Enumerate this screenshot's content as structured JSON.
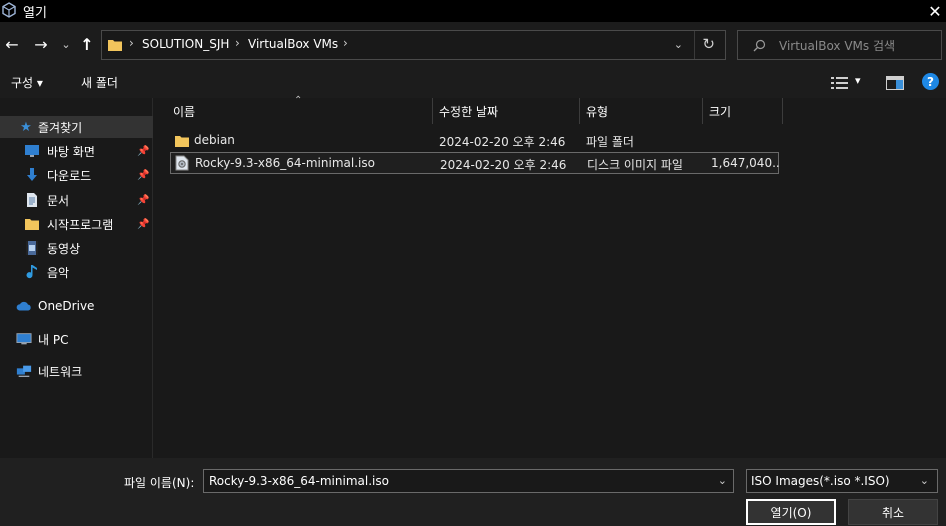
{
  "window": {
    "title": "열기",
    "close_label": "✕"
  },
  "nav": {
    "back": "←",
    "forward": "→",
    "recent": "⌄",
    "up": "↑",
    "breadcrumb": [
      "SOLUTION_SJH",
      "VirtualBox VMs"
    ],
    "separator": "›",
    "dropdown": "⌄",
    "refresh": "↻"
  },
  "search": {
    "placeholder": "VirtualBox VMs 검색"
  },
  "toolbar": {
    "organize": "구성 ▾",
    "new_folder": "새 폴더",
    "view_dropdown": "▾",
    "help": "?"
  },
  "sidebar": {
    "items": [
      {
        "label": "즐겨찾기",
        "icon": "star-icon",
        "pinned": false,
        "selected": true
      },
      {
        "label": "바탕 화면",
        "icon": "desktop-icon",
        "pinned": true
      },
      {
        "label": "다운로드",
        "icon": "download-icon",
        "pinned": true
      },
      {
        "label": "문서",
        "icon": "document-icon",
        "pinned": true
      },
      {
        "label": "시작프로그램",
        "icon": "folder-icon",
        "pinned": true
      },
      {
        "label": "동영상",
        "icon": "video-icon",
        "pinned": false
      },
      {
        "label": "음악",
        "icon": "music-icon",
        "pinned": false
      },
      {
        "label": "OneDrive",
        "icon": "cloud-icon",
        "pinned": false
      },
      {
        "label": "내 PC",
        "icon": "computer-icon",
        "pinned": false
      },
      {
        "label": "네트워크",
        "icon": "network-icon",
        "pinned": false
      }
    ],
    "pin_glyph": "📌"
  },
  "columns": {
    "name": "이름",
    "date": "수정한 날짜",
    "type": "유형",
    "size": "크기"
  },
  "files": [
    {
      "name": "debian",
      "date": "2024-02-20 오후 2:46",
      "type": "파일 폴더",
      "size": "",
      "icon": "folder-icon",
      "selected": false
    },
    {
      "name": "Rocky-9.3-x86_64-minimal.iso",
      "date": "2024-02-20 오후 2:46",
      "type": "디스크 이미지 파일",
      "size": "1,647,040...",
      "icon": "disc-image-icon",
      "selected": true
    }
  ],
  "footer": {
    "filename_label": "파일 이름(N):",
    "filename_value": "Rocky-9.3-x86_64-minimal.iso",
    "filetype_value": "ISO Images(*.iso *.ISO)",
    "open_button": "열기(O)",
    "cancel_button": "취소",
    "dropdown": "⌄"
  },
  "colors": {
    "accent": "#1e88e5",
    "folder": "#f2c55c",
    "background": "#191919"
  }
}
